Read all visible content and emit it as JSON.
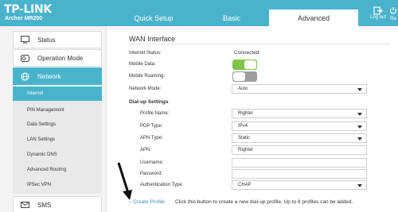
{
  "header": {
    "brand": "TP-LINK",
    "model": "Archer MR200",
    "tabs": [
      "Quick Setup",
      "Basic",
      "Advanced"
    ],
    "logout_label": "Log out",
    "reboot_label": "Re",
    "bg_color": "#4ab3cc"
  },
  "sidebar": {
    "items": [
      {
        "label": "Status",
        "icon": "status-icon"
      },
      {
        "label": "Operation Mode",
        "icon": "operation-mode-icon"
      },
      {
        "label": "Network",
        "icon": "network-globe-icon"
      },
      {
        "label": "SMS",
        "icon": "envelope-icon"
      }
    ],
    "subitems": [
      "Internet",
      "PIN Management",
      "Data Settings",
      "LAN Settings",
      "Dynamic DNS",
      "Advanced Routing",
      "IPSec VPN"
    ]
  },
  "main": {
    "title": "WAN Interface",
    "internet_status_label": "Internet Status:",
    "internet_status_value": "Connected",
    "mobile_data_label": "Mobile Data:",
    "mobile_data_on": true,
    "mobile_roaming_label": "Mobile Roaming:",
    "mobile_roaming_on": false,
    "network_mode_label": "Network Mode:",
    "network_mode_value": "Auto",
    "dialup_heading": "Dial-up Settings",
    "profile_name_label": "Profile Name:",
    "profile_name_value": "Rightel",
    "pdp_type_label": "PDP Type:",
    "pdp_type_value": "IPv4",
    "apn_type_label": "APN Type:",
    "apn_type_value": "Static",
    "apn_label": "APN:",
    "apn_value": "Rightel",
    "username_label": "Username:",
    "username_value": "",
    "password_label": "Password:",
    "password_value": "",
    "auth_type_label": "Authentication Type:",
    "auth_type_value": "CHAP",
    "create_profile_link": "Create Profile",
    "create_profile_desc": "Click this button to create a new dial-up profile. Up to 8 profiles can be added."
  }
}
